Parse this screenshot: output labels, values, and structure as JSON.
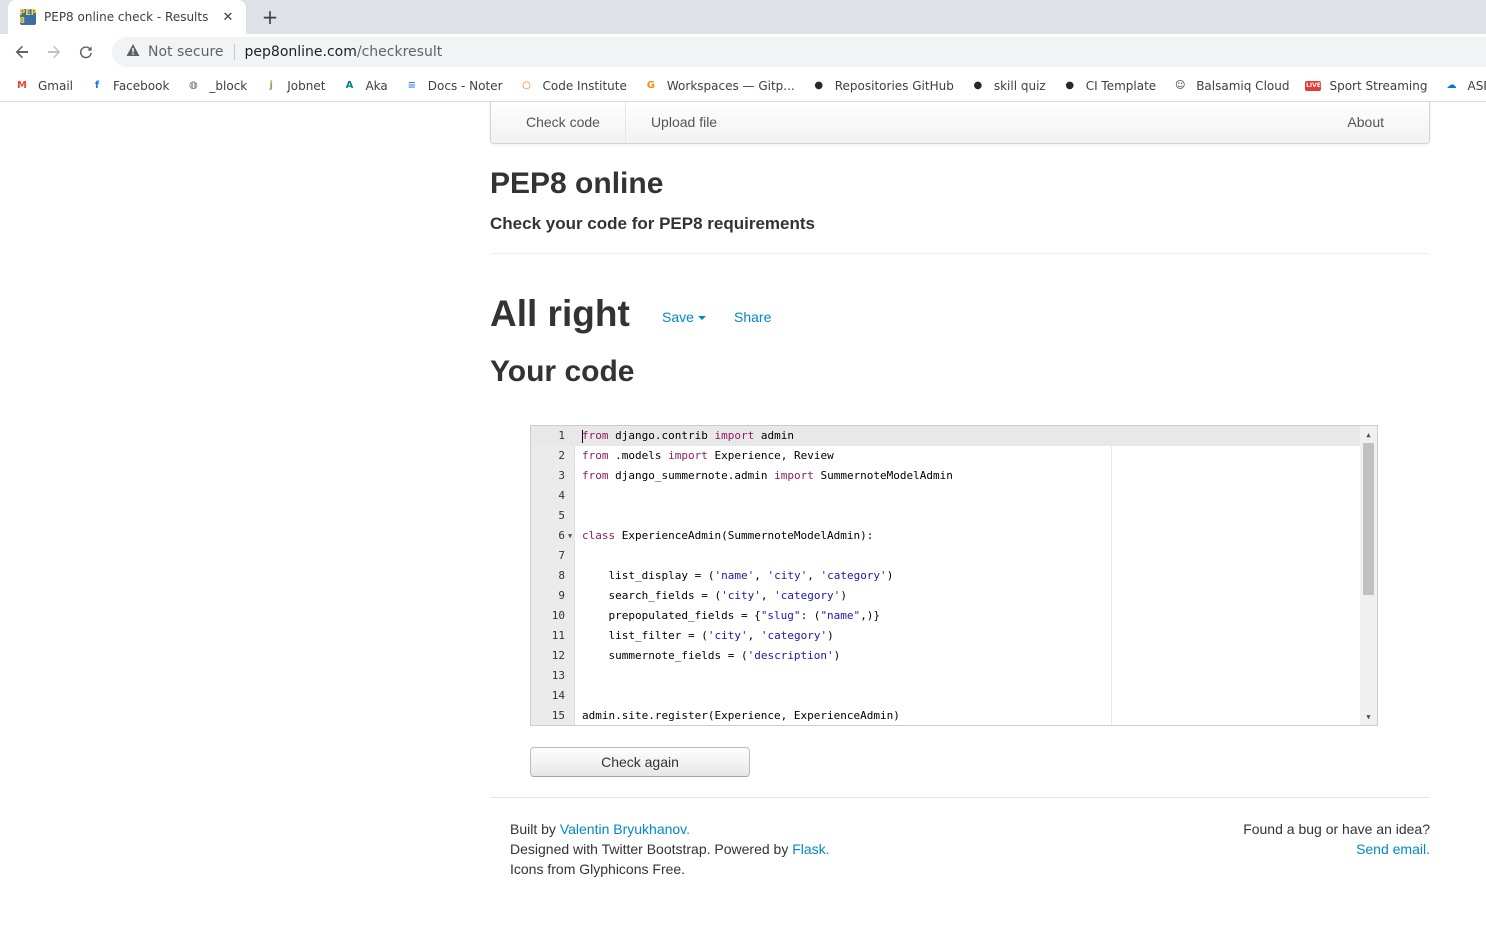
{
  "browser": {
    "tab_title": "PEP8 online check - Results",
    "favicon_text": "PEP 8",
    "not_secure": "Not secure",
    "url_host": "pep8online.com",
    "url_path": "/checkresult",
    "bookmarks": [
      {
        "label": "Gmail",
        "icon": "gmail-icon",
        "color": "#ea4335",
        "glyph": "M"
      },
      {
        "label": "Facebook",
        "icon": "facebook-icon",
        "color": "#1877f2",
        "glyph": "f"
      },
      {
        "label": "_block",
        "icon": "globe-icon",
        "color": "#5f6368",
        "glyph": "◍"
      },
      {
        "label": "Jobnet",
        "icon": "jobnet-icon",
        "color": "#7cb342",
        "glyph": "j"
      },
      {
        "label": "Aka",
        "icon": "aka-icon",
        "color": "#00897b",
        "glyph": "A"
      },
      {
        "label": "Docs - Noter",
        "icon": "docs-icon",
        "color": "#4285f4",
        "glyph": "≡"
      },
      {
        "label": "Code Institute",
        "icon": "code-institute-icon",
        "color": "#ff6d00",
        "glyph": "○"
      },
      {
        "label": "Workspaces — Gitp...",
        "icon": "gitpod-icon",
        "color": "#ff8a00",
        "glyph": "G"
      },
      {
        "label": "Repositories GitHub",
        "icon": "github-icon",
        "color": "#24292e",
        "glyph": "●"
      },
      {
        "label": "skill quiz",
        "icon": "github-icon",
        "color": "#24292e",
        "glyph": "●"
      },
      {
        "label": "CI Template",
        "icon": "github-icon",
        "color": "#24292e",
        "glyph": "●"
      },
      {
        "label": "Balsamiq Cloud",
        "icon": "smiley-icon",
        "color": "#333333",
        "glyph": "☺"
      },
      {
        "label": "Sport Streaming",
        "icon": "live-icon",
        "color": "#e53935",
        "glyph": "LIVE"
      },
      {
        "label": "ASP_Net_",
        "icon": "cloud-icon",
        "color": "#0078d4",
        "glyph": "☁"
      }
    ]
  },
  "nav": {
    "check_code": "Check code",
    "upload_file": "Upload file",
    "about": "About"
  },
  "header": {
    "title": "PEP8 online",
    "subtitle": "Check your code for PEP8 requirements"
  },
  "result": {
    "status": "All right",
    "save_label": "Save",
    "share_label": "Share",
    "code_heading": "Your code"
  },
  "editor": {
    "lines": [
      {
        "n": "1",
        "text": "from django.contrib import admin"
      },
      {
        "n": "2",
        "text": "from .models import Experience, Review"
      },
      {
        "n": "3",
        "text": "from django_summernote.admin import SummernoteModelAdmin"
      },
      {
        "n": "4",
        "text": ""
      },
      {
        "n": "5",
        "text": ""
      },
      {
        "n": "6",
        "text": "class ExperienceAdmin(SummernoteModelAdmin):"
      },
      {
        "n": "7",
        "text": ""
      },
      {
        "n": "8",
        "text": "    list_display = ('name', 'city', 'category')"
      },
      {
        "n": "9",
        "text": "    search_fields = ('city', 'category')"
      },
      {
        "n": "10",
        "text": "    prepopulated_fields = {\"slug\": (\"name\",)}"
      },
      {
        "n": "11",
        "text": "    list_filter = ('city', 'category')"
      },
      {
        "n": "12",
        "text": "    summernote_fields = ('description')"
      },
      {
        "n": "13",
        "text": ""
      },
      {
        "n": "14",
        "text": ""
      },
      {
        "n": "15",
        "text": "admin.site.register(Experience, ExperienceAdmin)"
      }
    ]
  },
  "actions": {
    "check_again": "Check again"
  },
  "footer": {
    "built_by": "Built by ",
    "author": "Valentin Bryukhanov",
    "period1": ".",
    "designed": "Designed with Twitter Bootstrap. Powered by ",
    "flask": "Flask",
    "period2": ".",
    "icons": "Icons from Glyphicons Free.",
    "bug_text": "Found a bug or have an idea?",
    "send_email": "Send email",
    "period3": "."
  }
}
